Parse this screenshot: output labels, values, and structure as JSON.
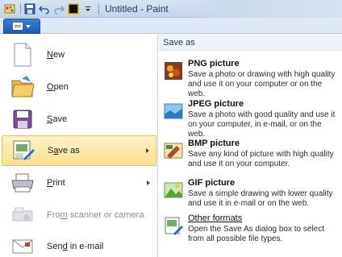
{
  "window": {
    "title": "Untitled - Paint"
  },
  "menu": {
    "items": [
      {
        "label": "New",
        "accel": "N"
      },
      {
        "label": "Open",
        "accel": "O"
      },
      {
        "label": "Save",
        "accel": "S"
      },
      {
        "label": "Save as",
        "accel": "a"
      },
      {
        "label": "Print",
        "accel": "P"
      },
      {
        "label": "From scanner or camera",
        "accel": "m"
      },
      {
        "label": "Send in e-mail",
        "accel": "d"
      }
    ]
  },
  "save_as": {
    "header": "Save as",
    "options": [
      {
        "title": "PNG picture",
        "description": "Save a photo or drawing with high quality and use it on your computer or on the web."
      },
      {
        "title": "JPEG picture",
        "description": "Save a photo with good quality and use it on your computer, in e-mail, or on the web."
      },
      {
        "title": "BMP picture",
        "description": "Save any kind of picture with high quality and use it on your computer."
      },
      {
        "title": "GIF picture",
        "description": "Save a simple drawing with lower quality and use it in e-mail or on the web."
      },
      {
        "title": "Other formats",
        "description": "Open the Save As dialog box to select from all possible file types."
      }
    ]
  },
  "colors": {
    "accent": "#1b5cae",
    "selection": "#fbe08e"
  }
}
